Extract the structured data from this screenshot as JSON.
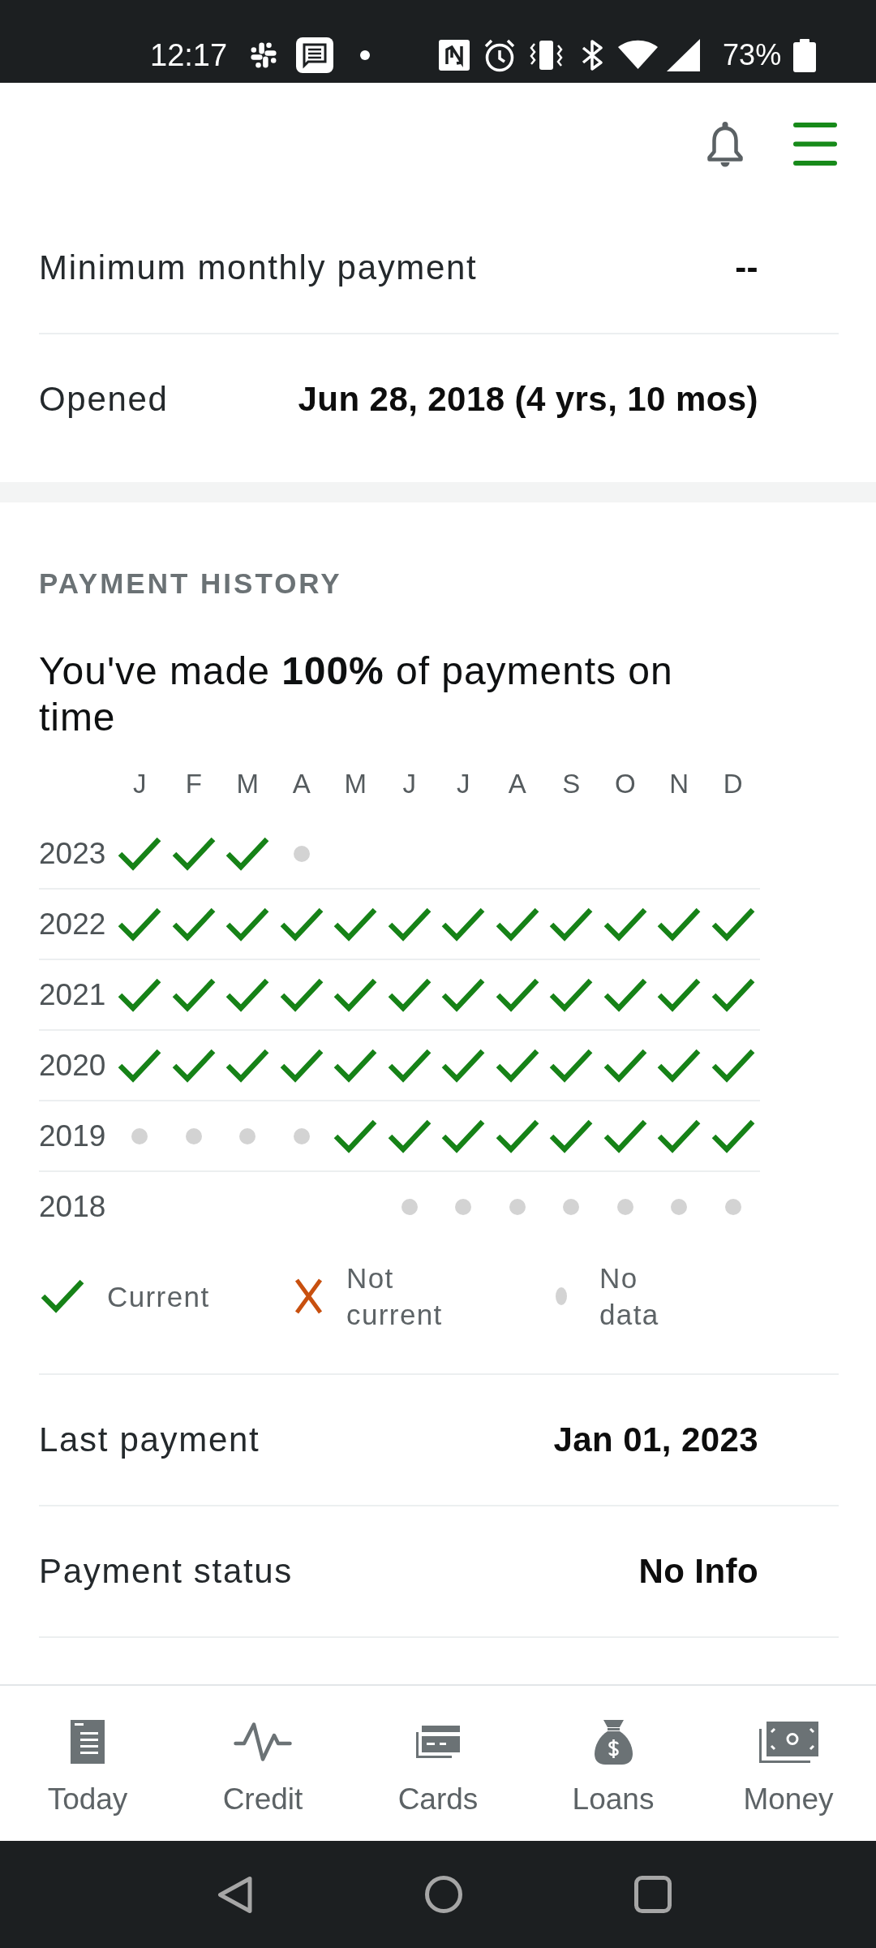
{
  "status_bar": {
    "time": "12:17",
    "battery": "73%"
  },
  "account_details": [
    {
      "label": "Minimum monthly payment",
      "value": "--"
    },
    {
      "label": "Opened",
      "value": "Jun 28, 2018 (4 yrs, 10 mos)"
    }
  ],
  "payment_history": {
    "heading": "PAYMENT HISTORY",
    "summary": "You've made **100%** of payments on time",
    "months": [
      "J",
      "F",
      "M",
      "A",
      "M",
      "J",
      "J",
      "A",
      "S",
      "O",
      "N",
      "D"
    ],
    "years": [
      {
        "year": "2023",
        "cells": [
          {
            "kind": "current"
          },
          {
            "kind": "current"
          },
          {
            "kind": "current"
          },
          {
            "kind": "no_data"
          },
          null,
          null,
          null,
          null,
          null,
          null,
          null,
          null
        ]
      },
      {
        "year": "2022",
        "cells": [
          {
            "kind": "current"
          },
          {
            "kind": "current"
          },
          {
            "kind": "current"
          },
          {
            "kind": "current"
          },
          {
            "kind": "current"
          },
          {
            "kind": "current"
          },
          {
            "kind": "current"
          },
          {
            "kind": "current"
          },
          {
            "kind": "current"
          },
          {
            "kind": "current"
          },
          {
            "kind": "current"
          },
          {
            "kind": "current"
          }
        ]
      },
      {
        "year": "2021",
        "cells": [
          {
            "kind": "current"
          },
          {
            "kind": "current"
          },
          {
            "kind": "current"
          },
          {
            "kind": "current"
          },
          {
            "kind": "current"
          },
          {
            "kind": "current"
          },
          {
            "kind": "current"
          },
          {
            "kind": "current"
          },
          {
            "kind": "current"
          },
          {
            "kind": "current"
          },
          {
            "kind": "current"
          },
          {
            "kind": "current"
          }
        ]
      },
      {
        "year": "2020",
        "cells": [
          {
            "kind": "current"
          },
          {
            "kind": "current"
          },
          {
            "kind": "current"
          },
          {
            "kind": "current"
          },
          {
            "kind": "current"
          },
          {
            "kind": "current"
          },
          {
            "kind": "current"
          },
          {
            "kind": "current"
          },
          {
            "kind": "current"
          },
          {
            "kind": "current"
          },
          {
            "kind": "current"
          },
          {
            "kind": "current"
          }
        ]
      },
      {
        "year": "2019",
        "cells": [
          {
            "kind": "no_data"
          },
          {
            "kind": "no_data"
          },
          {
            "kind": "no_data"
          },
          {
            "kind": "no_data"
          },
          {
            "kind": "current"
          },
          {
            "kind": "current"
          },
          {
            "kind": "current"
          },
          {
            "kind": "current"
          },
          {
            "kind": "current"
          },
          {
            "kind": "current"
          },
          {
            "kind": "current"
          },
          {
            "kind": "current"
          }
        ]
      },
      {
        "year": "2018",
        "cells": [
          null,
          null,
          null,
          null,
          null,
          {
            "kind": "no_data"
          },
          {
            "kind": "no_data"
          },
          {
            "kind": "no_data"
          },
          {
            "kind": "no_data"
          },
          {
            "kind": "no_data"
          },
          {
            "kind": "no_data"
          },
          {
            "kind": "no_data"
          }
        ]
      }
    ],
    "legend": [
      {
        "kind": "current",
        "label": "Current"
      },
      {
        "kind": "not_current",
        "label": "Not current"
      },
      {
        "kind": "no_data",
        "label": "No data"
      }
    ]
  },
  "payment_details": [
    {
      "label": "Last payment",
      "value": "Jan 01, 2023"
    },
    {
      "label": "Payment status",
      "value": "No Info"
    }
  ],
  "bottom_nav": [
    {
      "label": "Today",
      "selected": false
    },
    {
      "label": "Credit",
      "selected": false
    },
    {
      "label": "Cards",
      "selected": false
    },
    {
      "label": "Loans",
      "selected": false
    },
    {
      "label": "Money",
      "selected": false
    }
  ]
}
